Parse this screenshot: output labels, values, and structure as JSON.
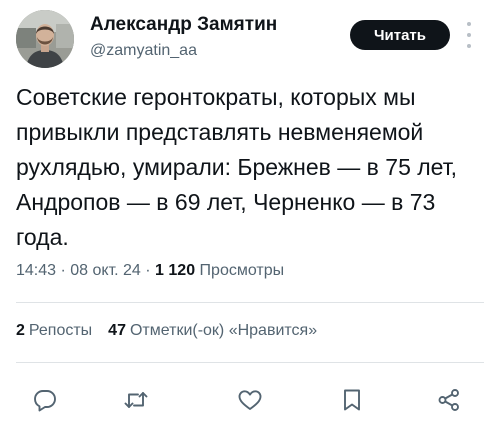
{
  "author": {
    "name": "Александр Замятин",
    "handle": "@zamyatin_aa"
  },
  "follow_button_label": "Читать",
  "tweet_text": "Советские геронтократы, которых мы привыкли представлять невменяемой рухлядью, умирали: Брежнев — в 75 лет, Андропов — в 69 лет, Черненко — в 73 года.",
  "meta": {
    "time": "14:43",
    "separator": " · ",
    "date": "08 окт. 24",
    "views_count": "1 120",
    "views_label": "Просмотры"
  },
  "stats": {
    "reposts_count": "2",
    "reposts_label": "Репосты",
    "likes_count": "47",
    "likes_label": "Отметки(-ок) «Нравится»"
  },
  "actions": [
    {
      "name": "reply",
      "icon": "reply-icon"
    },
    {
      "name": "repost",
      "icon": "repost-icon"
    },
    {
      "name": "like",
      "icon": "heart-icon"
    },
    {
      "name": "bookmark",
      "icon": "bookmark-icon"
    },
    {
      "name": "share",
      "icon": "share-icon"
    }
  ]
}
